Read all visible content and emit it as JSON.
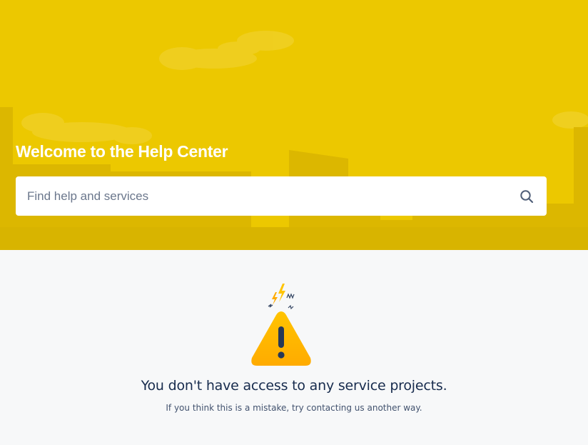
{
  "hero": {
    "title": "Welcome to the Help Center",
    "background_color": "#ecc800"
  },
  "search": {
    "placeholder": "Find help and services",
    "value": "",
    "icon": "search-icon"
  },
  "empty_state": {
    "icon": "warning-icon",
    "title": "You don't have access to any service projects.",
    "subtitle": "If you think this is a mistake, try contacting us another way.",
    "accent_color": "#ffab00"
  }
}
